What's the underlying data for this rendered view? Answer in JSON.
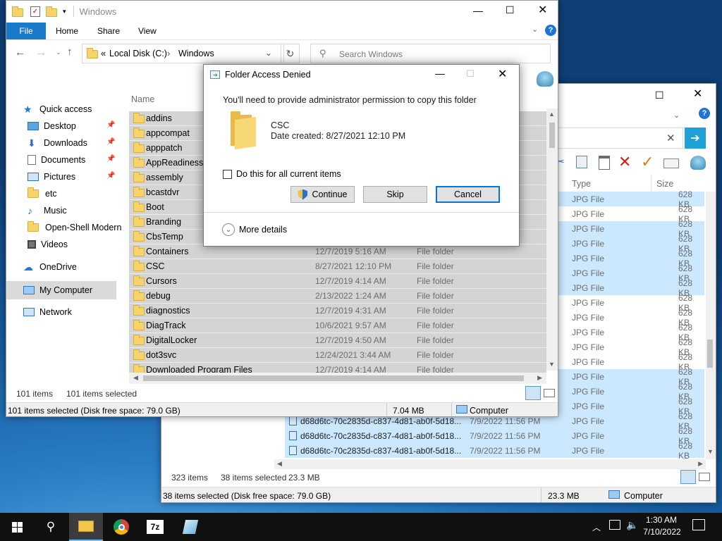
{
  "back_window": {
    "columns": {
      "type": "Type",
      "size": "Size"
    },
    "rows": [
      {
        "name": "",
        "date": "",
        "type": "JPG File",
        "size": "628 KB",
        "sel": true
      },
      {
        "name": "",
        "date": "",
        "type": "JPG File",
        "size": "628 KB",
        "sel": false
      },
      {
        "name": "",
        "date": "",
        "type": "JPG File",
        "size": "628 KB",
        "sel": true
      },
      {
        "name": "",
        "date": "",
        "type": "JPG File",
        "size": "628 KB",
        "sel": true
      },
      {
        "name": "",
        "date": "",
        "type": "JPG File",
        "size": "628 KB",
        "sel": true
      },
      {
        "name": "",
        "date": "",
        "type": "JPG File",
        "size": "628 KB",
        "sel": true
      },
      {
        "name": "",
        "date": "",
        "type": "JPG File",
        "size": "628 KB",
        "sel": true
      },
      {
        "name": "",
        "date": "",
        "type": "JPG File",
        "size": "628 KB",
        "sel": false
      },
      {
        "name": "",
        "date": "",
        "type": "JPG File",
        "size": "628 KB",
        "sel": false
      },
      {
        "name": "",
        "date": "",
        "type": "JPG File",
        "size": "628 KB",
        "sel": false
      },
      {
        "name": "",
        "date": "",
        "type": "JPG File",
        "size": "628 KB",
        "sel": false
      },
      {
        "name": "",
        "date": "",
        "type": "JPG File",
        "size": "628 KB",
        "sel": false
      },
      {
        "name": "",
        "date": "",
        "type": "JPG File",
        "size": "628 KB",
        "sel": true
      },
      {
        "name": "",
        "date": "",
        "type": "JPG File",
        "size": "628 KB",
        "sel": true
      },
      {
        "name": "",
        "date": "",
        "type": "JPG File",
        "size": "628 KB",
        "sel": true
      },
      {
        "name": "d68d6tc-70c2835d-c837-4d81-ab0f-5d18...",
        "date": "7/9/2022 11:56 PM",
        "type": "JPG File",
        "size": "628 KB",
        "sel": true
      },
      {
        "name": "d68d6tc-70c2835d-c837-4d81-ab0f-5d18...",
        "date": "7/9/2022 11:56 PM",
        "type": "JPG File",
        "size": "628 KB",
        "sel": true
      },
      {
        "name": "d68d6tc-70c2835d-c837-4d81-ab0f-5d18...",
        "date": "7/9/2022 11:56 PM",
        "type": "JPG File",
        "size": "628 KB",
        "sel": true
      }
    ],
    "status_items": "323 items",
    "status_selected": "38 items selected",
    "status_size": "23.3 MB",
    "details": "38 items selected (Disk free space: 79.0 GB)",
    "details_size": "23.3 MB",
    "details_location": "Computer"
  },
  "front_window": {
    "title": "Windows",
    "tabs": [
      "File",
      "Home",
      "Share",
      "View"
    ],
    "address": {
      "prefix": "«",
      "drive": "Local Disk (C:)",
      "sep": "›",
      "folder": "Windows"
    },
    "search_placeholder": "Search Windows",
    "column_name": "Name",
    "nav": {
      "quick_access": "Quick access",
      "items": [
        "Desktop",
        "Downloads",
        "Documents",
        "Pictures",
        "etc",
        "Music",
        "Open-Shell Modern",
        "Videos"
      ],
      "onedrive": "OneDrive",
      "my_computer": "My Computer",
      "network": "Network"
    },
    "rows": [
      {
        "name": "addins",
        "date": "",
        "type": ""
      },
      {
        "name": "appcompat",
        "date": "",
        "type": ""
      },
      {
        "name": "apppatch",
        "date": "",
        "type": ""
      },
      {
        "name": "AppReadiness",
        "date": "",
        "type": ""
      },
      {
        "name": "assembly",
        "date": "",
        "type": ""
      },
      {
        "name": "bcastdvr",
        "date": "",
        "type": ""
      },
      {
        "name": "Boot",
        "date": "",
        "type": ""
      },
      {
        "name": "Branding",
        "date": "",
        "type": ""
      },
      {
        "name": "CbsTemp",
        "date": "",
        "type": ""
      },
      {
        "name": "Containers",
        "date": "12/7/2019 5:16 AM",
        "type": "File folder"
      },
      {
        "name": "CSC",
        "date": "8/27/2021 12:10 PM",
        "type": "File folder"
      },
      {
        "name": "Cursors",
        "date": "12/7/2019 4:14 AM",
        "type": "File folder"
      },
      {
        "name": "debug",
        "date": "2/13/2022 1:24 AM",
        "type": "File folder"
      },
      {
        "name": "diagnostics",
        "date": "12/7/2019 4:31 AM",
        "type": "File folder"
      },
      {
        "name": "DiagTrack",
        "date": "10/6/2021 9:57 AM",
        "type": "File folder"
      },
      {
        "name": "DigitalLocker",
        "date": "12/7/2019 4:50 AM",
        "type": "File folder"
      },
      {
        "name": "dot3svc",
        "date": "12/24/2021 3:44 AM",
        "type": "File folder"
      },
      {
        "name": "Downloaded Program Files",
        "date": "12/7/2019 4:14 AM",
        "type": "File folder"
      }
    ],
    "status_items": "101 items",
    "status_selected": "101 items selected",
    "details": "101 items selected (Disk free space: 79.0 GB)",
    "details_size": "7.04 MB",
    "details_location": "Computer"
  },
  "dialog": {
    "title": "Folder Access Denied",
    "message": "You'll need to provide administrator permission to copy this folder",
    "folder_name": "CSC",
    "folder_date": "Date created: 8/27/2021 12:10 PM",
    "checkbox_label": "Do this for all current items",
    "btn_continue": "Continue",
    "btn_skip": "Skip",
    "btn_cancel": "Cancel",
    "more_details": "More details"
  },
  "taskbar": {
    "time": "1:30 AM",
    "date": "7/10/2022"
  }
}
